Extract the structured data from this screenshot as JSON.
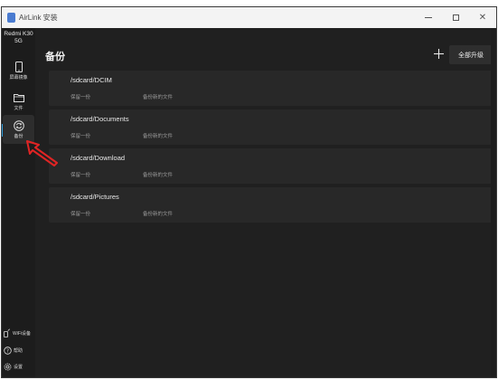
{
  "window": {
    "title": "AirLink 安装"
  },
  "sidebar": {
    "device_name": "Redmi K30 5G",
    "nav": [
      {
        "label": "屏幕镜像",
        "icon": "phone-icon"
      },
      {
        "label": "文件",
        "icon": "folder-icon"
      },
      {
        "label": "备份",
        "icon": "sync-icon",
        "active": true
      }
    ],
    "bottom": [
      {
        "label": "WiFi设备",
        "icon": "wifi-device-icon"
      },
      {
        "label": "帮助",
        "icon": "help-icon"
      },
      {
        "label": "设置",
        "icon": "settings-icon"
      }
    ]
  },
  "main": {
    "title": "备份",
    "add_label": "+",
    "upgrade_label": "全部升级",
    "rows": [
      {
        "path": "/sdcard/DCIM",
        "mode": "保留一份",
        "scope": "备份新的文件"
      },
      {
        "path": "/sdcard/Documents",
        "mode": "保留一份",
        "scope": "备份新的文件"
      },
      {
        "path": "/sdcard/Download",
        "mode": "保留一份",
        "scope": "备份新的文件"
      },
      {
        "path": "/sdcard/Pictures",
        "mode": "保留一份",
        "scope": "备份新的文件"
      }
    ]
  },
  "colors": {
    "accent": "#2f9bd8",
    "annotation": "#e02424",
    "background": "#202020"
  }
}
